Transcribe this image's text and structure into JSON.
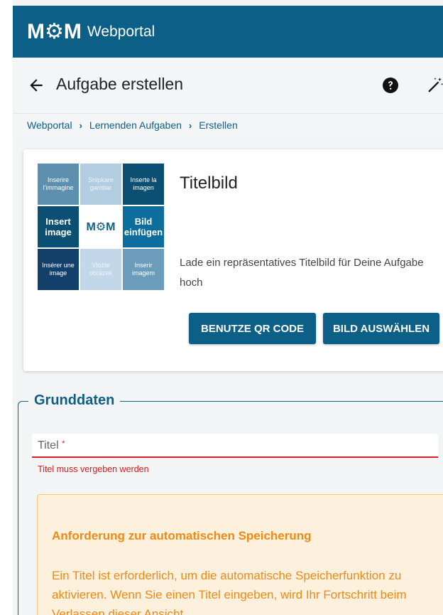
{
  "app": {
    "logo_mark": "M⚙M",
    "logo_text": "Webportal",
    "brand_color": "#0c5f86"
  },
  "header": {
    "back_icon": "arrow-left-icon",
    "title": "Aufgabe erstellen",
    "help_icon": "question-circle-icon",
    "wand_icon": "magic-wand-icon"
  },
  "breadcrumb": {
    "items": [
      "Webportal",
      "Lernenden Aufgaben",
      "Erstellen"
    ],
    "separator": "›"
  },
  "title_image_card": {
    "tiles": [
      "Inserire l'immagine",
      "Snipkare gambar",
      "Inserte la imagen",
      "Insert image",
      "M⚙M",
      "Bild einfügen",
      "Insérer une image",
      "Vložte obrázek",
      "Inserir imagem"
    ],
    "title": "Titelbild",
    "description": "Lade ein repräsentatives Titelbild für Deine Aufgabe hoch",
    "qr_button_label": "BENUTZE QR CODE",
    "select_image_button_label": "BILD AUSWÄHLEN"
  },
  "grunddaten": {
    "legend": "Grunddaten",
    "title_field": {
      "label": "Titel",
      "required_marker": "*",
      "value": ""
    },
    "error_message": "Titel muss vergeben werden",
    "autosave_notice": {
      "title": "Anforderung zur automatischen Speicherung",
      "body": "Ein Titel ist erforderlich, um die automatische Speicherfunktion zu aktivieren. Wenn Sie einen Titel eingeben, wird Ihr Fortschritt beim Verlassen dieser Ansicht"
    }
  },
  "colors": {
    "error": "#d32020",
    "warning_text": "#ee8a16",
    "warning_bg": "#fdf0dc"
  }
}
